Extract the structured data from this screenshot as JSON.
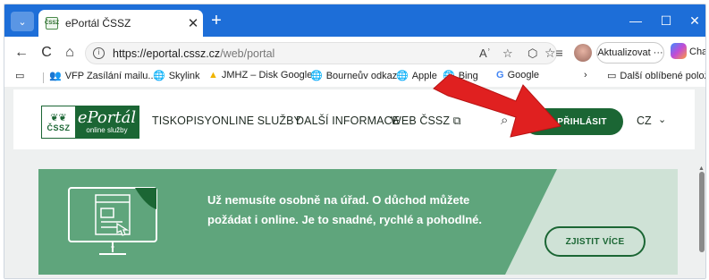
{
  "browser": {
    "tab": {
      "title": "ePortál ČSSZ",
      "favicon_text": "ČSSZ",
      "close_glyph": "✕"
    },
    "new_tab_glyph": "+",
    "window": {
      "minimize": "—",
      "maximize": "☐",
      "close": "✕"
    },
    "nav": {
      "back": "←",
      "reload": "C",
      "home": "⌂"
    },
    "url": {
      "scheme_host": "https://eportal.cssz.cz",
      "path": "/web/portal"
    },
    "update_button": "Aktualizovat",
    "update_more": "···",
    "chat_label": "Chat"
  },
  "favorites": [
    {
      "label": "VFP Zasílání mailu...",
      "icon": "people-icon"
    },
    {
      "label": "Skylink",
      "icon": "globe-icon"
    },
    {
      "label": "JMHZ – Disk Google",
      "icon": "drive-icon"
    },
    {
      "label": "Bourneův odkaz",
      "icon": "globe-icon"
    },
    {
      "label": "Apple",
      "icon": "globe-icon"
    },
    {
      "label": "Bing",
      "icon": "globe-icon"
    },
    {
      "label": "Google",
      "icon": "google-icon"
    }
  ],
  "favorites_more": "›",
  "favorites_other": "Další oblíbené položky",
  "site": {
    "logo": {
      "title": "ePortál",
      "subtitle": "online služby",
      "org": "ČSSZ"
    },
    "nav": [
      "TISKOPISY",
      "ONLINE SLUŽBY",
      "DALŠÍ INFORMACE",
      "WEB ČSSZ"
    ],
    "external_glyph": "⧉",
    "login_label": "PŘIHLÁSIT",
    "language": "CZ"
  },
  "banner": {
    "text": "Už nemusíte osobně na úřad. O důchod můžete požádat i online. Je to snadné, rychlé a pohodlné.",
    "cta": "ZJISTIT VÍCE"
  },
  "colors": {
    "brand_green": "#1b6634",
    "banner_green": "#5fa57c",
    "banner_light": "#cfe2d6",
    "titlebar_blue": "#1d6ed8",
    "arrow_red": "#e02020"
  }
}
